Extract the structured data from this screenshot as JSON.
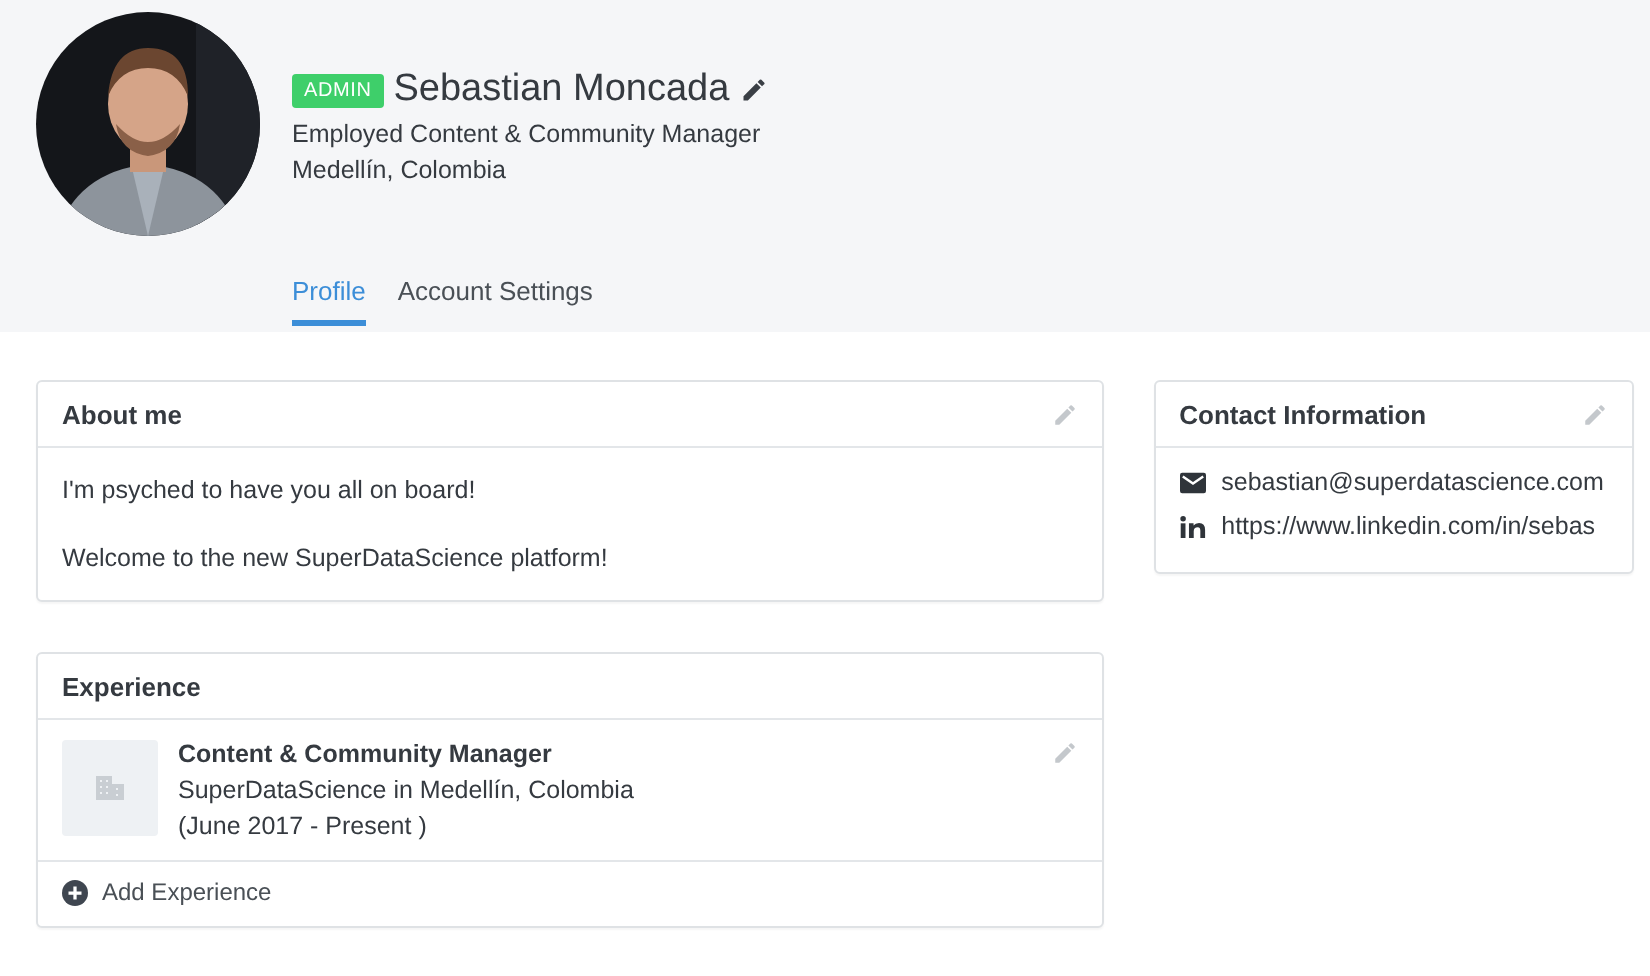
{
  "profile": {
    "badge": "ADMIN",
    "name": "Sebastian Moncada",
    "headline": "Employed Content & Community Manager",
    "location": "Medellín, Colombia"
  },
  "tabs": [
    {
      "label": "Profile",
      "selected": true
    },
    {
      "label": "Account Settings",
      "selected": false
    }
  ],
  "about": {
    "title": "About me",
    "paragraphs": [
      "I'm psyched to have you all on board!",
      "Welcome to the new SuperDataScience platform!"
    ]
  },
  "experience": {
    "title": "Experience",
    "items": [
      {
        "role": "Content & Community Manager",
        "company": "SuperDataScience in Medellín, Colombia",
        "period": "(June 2017 - Present )"
      }
    ],
    "add_label": "Add Experience"
  },
  "contact": {
    "title": "Contact Information",
    "items": [
      {
        "kind": "email",
        "text": "sebastian@superdatascience.com"
      },
      {
        "kind": "linkedin",
        "text": "https://www.linkedin.com/in/sebas"
      }
    ]
  }
}
